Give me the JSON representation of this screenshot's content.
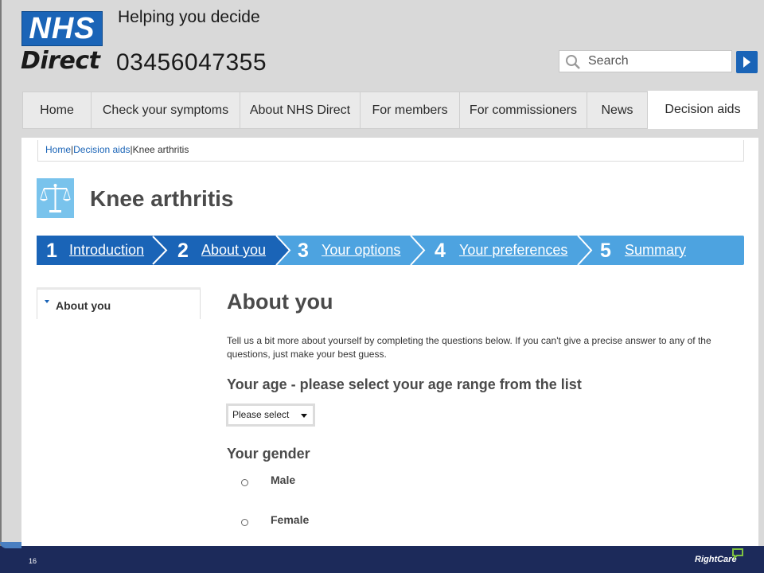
{
  "header": {
    "logo_top": "NHS",
    "logo_bottom": "Direct",
    "tagline": "Helping you decide",
    "phone": "03456047355",
    "search_placeholder": "Search"
  },
  "nav": [
    {
      "label": "Home"
    },
    {
      "label": "Check your symptoms"
    },
    {
      "label": "About NHS Direct"
    },
    {
      "label": "For members"
    },
    {
      "label": "For commissioners"
    },
    {
      "label": "News"
    },
    {
      "label": "Decision aids",
      "active": true
    }
  ],
  "breadcrumb": {
    "home": "Home",
    "section": "Decision aids",
    "current": "Knee arthritis",
    "sep": "|"
  },
  "page_title": "Knee arthritis",
  "steps": [
    {
      "num": "1",
      "label": "Introduction"
    },
    {
      "num": "2",
      "label": "About you"
    },
    {
      "num": "3",
      "label": "Your options"
    },
    {
      "num": "4",
      "label": "Your preferences"
    },
    {
      "num": "5",
      "label": "Summary"
    }
  ],
  "sidebar": {
    "item": "About you"
  },
  "main": {
    "heading": "About you",
    "intro": "Tell us a bit more about yourself by completing the questions below. If you can't give a precise answer to any of the questions, just make your best guess.",
    "age_label": "Your age - please select your age range from the list",
    "age_select": "Please select",
    "gender_label": "Your gender",
    "gender_options": [
      "Male",
      "Female"
    ]
  },
  "footer": {
    "page_number": "16",
    "brand": "RightCare"
  },
  "colors": {
    "nhs_blue": "#1a64b7",
    "step_dark": "#1a64b7",
    "step_light": "#4da3e0",
    "footer_navy": "#1c2a5a"
  }
}
